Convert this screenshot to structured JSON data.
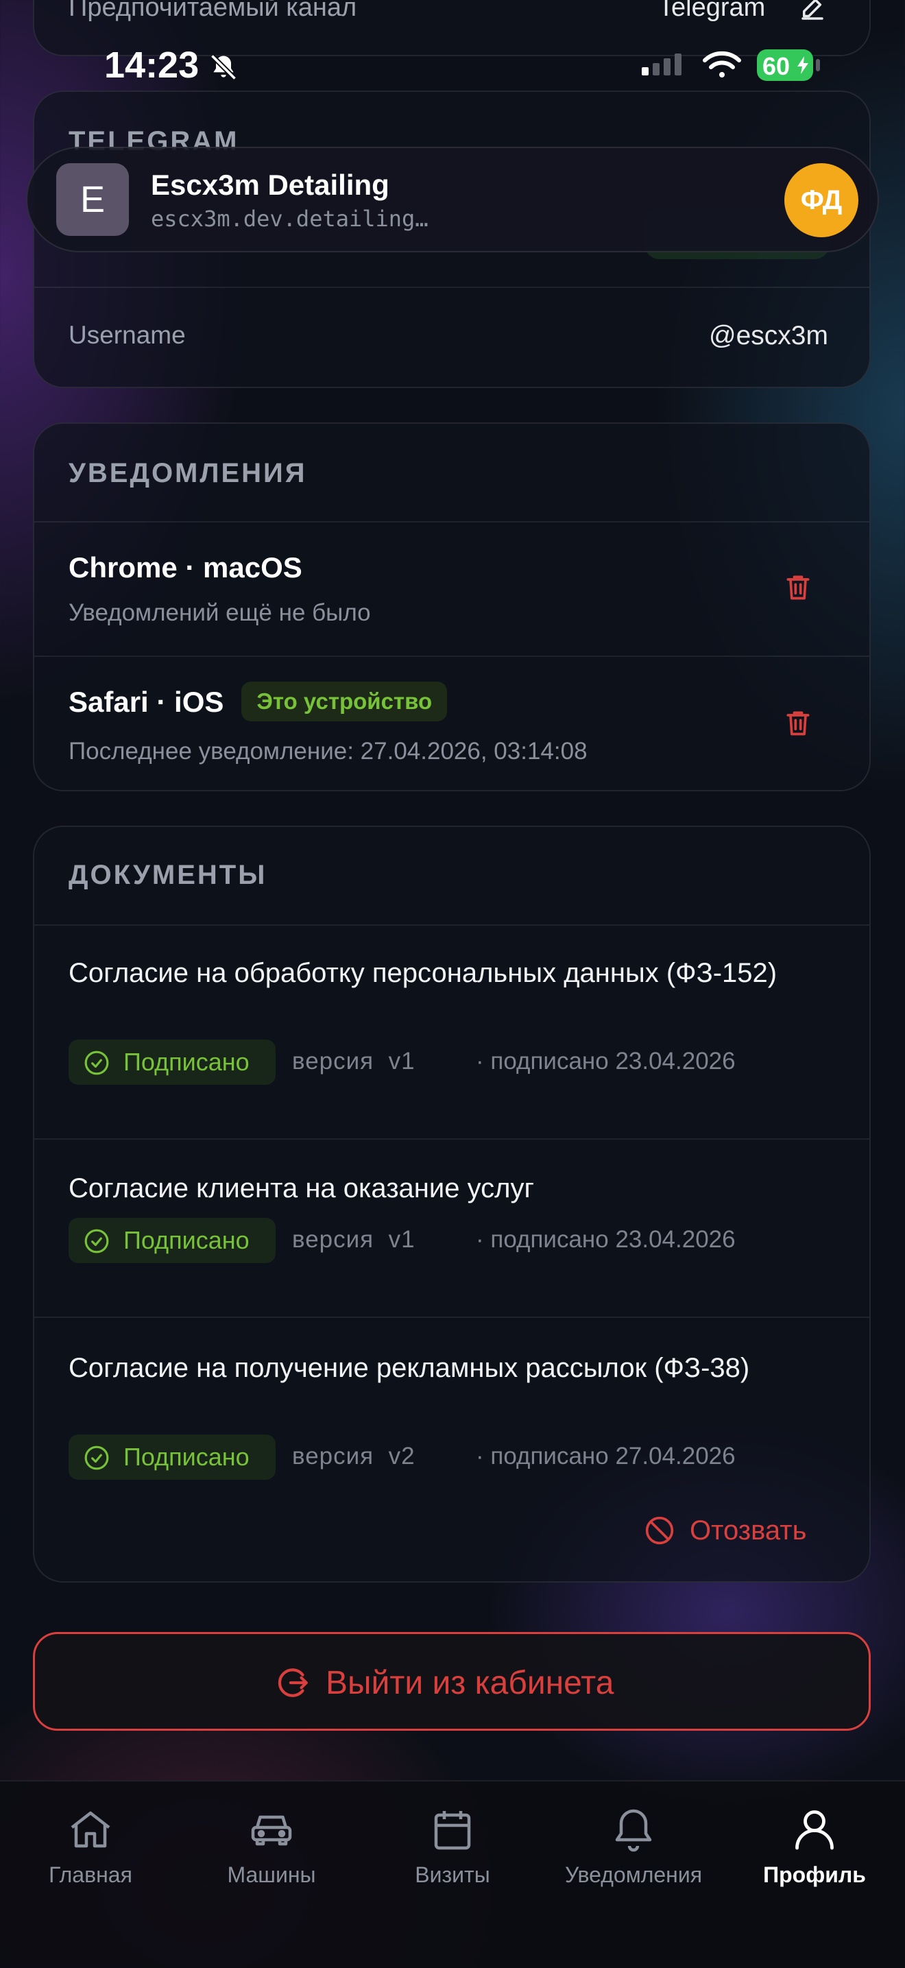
{
  "status_bar": {
    "time": "14:23",
    "battery": "60"
  },
  "contact": {
    "channel_label": "Предпочитаемый канал",
    "channel_value": "Telegram"
  },
  "telegram": {
    "title": "TELEGRAM",
    "username_label": "Username",
    "username_value": "@escx3m"
  },
  "app_header": {
    "logo_letter": "E",
    "title": "Escx3m Detailing",
    "url": "escx3m.dev.detailing…",
    "avatar_initials": "ФД"
  },
  "notifications": {
    "title": "УВЕДОМЛЕНИЯ",
    "devices": [
      {
        "name": "Chrome · macOS",
        "subtitle": "Уведомлений ещё не было",
        "badge": ""
      },
      {
        "name": "Safari · iOS",
        "subtitle": "Последнее уведомление: 27.04.2026, 03:14:08",
        "badge": "Это устройство"
      }
    ]
  },
  "documents": {
    "title": "ДОКУМЕНТЫ",
    "items": [
      {
        "title": "Согласие на обработку персональных данных (ФЗ-152)",
        "status": "Подписано",
        "version": "версия  v1",
        "signed": "· подписано 23.04.2026"
      },
      {
        "title": "Согласие клиента на оказание услуг",
        "status": "Подписано",
        "version": "версия  v1",
        "signed": "· подписано 23.04.2026"
      },
      {
        "title": "Согласие на получение рекламных рассылок (ФЗ-38)",
        "status": "Подписано",
        "version": "версия  v2",
        "signed": "· подписано 27.04.2026"
      }
    ],
    "revoke_label": "Отозвать"
  },
  "logout_label": "Выйти из кабинета",
  "tabbar": {
    "tabs": [
      {
        "label": "Главная",
        "icon": "home-icon"
      },
      {
        "label": "Машины",
        "icon": "car-icon"
      },
      {
        "label": "Визиты",
        "icon": "calendar-icon"
      },
      {
        "label": "Уведомления",
        "icon": "bell-icon"
      },
      {
        "label": "Профиль",
        "icon": "user-icon"
      }
    ],
    "active": "Профиль"
  },
  "colors": {
    "accent_red": "#d9403d",
    "success_green": "#78c23a",
    "avatar_orange": "#f4a91a",
    "battery_green": "#34c759"
  }
}
